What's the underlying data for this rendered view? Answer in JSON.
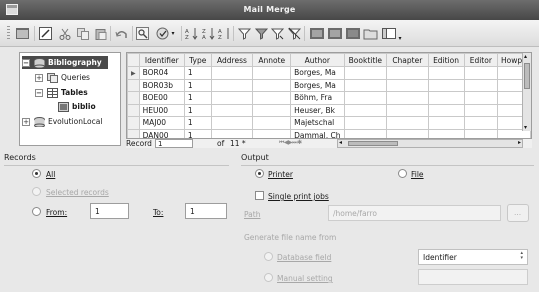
{
  "window": {
    "title": "Mail Merge"
  },
  "toolbar": {
    "icons": [
      "view-icon",
      "edit-icon",
      "cut-icon",
      "copy-icon",
      "paste-icon",
      "undo-icon",
      "find-icon",
      "spellcheck-icon",
      "sort-ascending-icon",
      "sort-descending-icon",
      "autofilter-icon",
      "standard-filter-icon",
      "remove-filter-icon",
      "data-to-text-icon",
      "data-to-fields-icon",
      "mail-merge-icon",
      "data-source-icon"
    ]
  },
  "tree": {
    "items": [
      {
        "label": "Bibliography",
        "expander": "⊟",
        "icon": "database-icon",
        "selected": true
      },
      {
        "label": "Queries",
        "expander": "⊞",
        "icon": "queries-icon"
      },
      {
        "label": "Tables",
        "expander": "⊟",
        "icon": "tables-icon"
      },
      {
        "label": "biblio",
        "icon": "table-icon"
      },
      {
        "label": "EvolutionLocal",
        "expander": "⊞",
        "icon": "database-icon"
      }
    ]
  },
  "grid": {
    "columns": [
      "Identifier",
      "Type",
      "Address",
      "Annote",
      "Author",
      "Booktitle",
      "Chapter",
      "Edition",
      "Editor",
      "Howpu"
    ],
    "rows": [
      [
        "BOR04",
        "1",
        "",
        "",
        "Borges, Ma",
        "",
        "",
        "",
        "",
        ""
      ],
      [
        "BOR03b",
        "1",
        "",
        "",
        "Borges, Ma",
        "",
        "",
        "",
        "",
        ""
      ],
      [
        "BOE00",
        "1",
        "",
        "",
        "Böhm, Fra",
        "",
        "",
        "",
        "",
        ""
      ],
      [
        "HEU00",
        "1",
        "",
        "",
        "Heuser, Bk",
        "",
        "",
        "",
        "",
        ""
      ],
      [
        "MAJ00",
        "1",
        "",
        "",
        "Majetschal",
        "",
        "",
        "",
        "",
        ""
      ],
      [
        "DAN00",
        "1",
        "",
        "",
        "Dammal, Ch",
        "",
        "",
        "",
        "",
        ""
      ]
    ]
  },
  "navbar": {
    "record_label": "Record",
    "record_value": "1",
    "of_label": "of",
    "total": "11 *"
  },
  "records": {
    "heading": "Records",
    "all": "All",
    "selected": "Selected records",
    "from_label": "From:",
    "from_value": "1",
    "to_label": "To:",
    "to_value": "1"
  },
  "output": {
    "heading": "Output",
    "printer": "Printer",
    "file": "File",
    "single_print_jobs": "Single print jobs",
    "path_label": "Path",
    "path_value": "/home/farro",
    "browse_label": "...",
    "generate_label": "Generate file name from",
    "database_field": "Database field",
    "database_field_value": "Identifier",
    "manual_setting": "Manual setting",
    "manual_value": ""
  }
}
